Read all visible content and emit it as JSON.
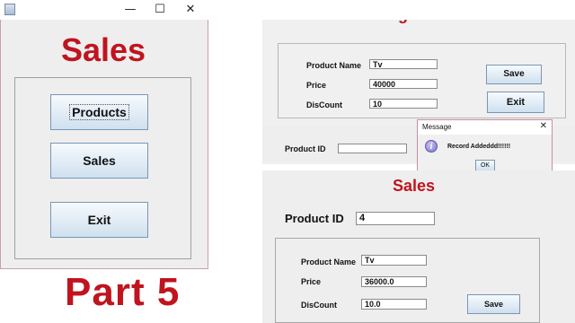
{
  "sales_window": {
    "minimize_glyph": "—",
    "maximize_glyph": "☐",
    "close_glyph": "✕",
    "heading": "Sales",
    "buttons": {
      "products": "Products",
      "sales": "Sales",
      "exit": "Exit"
    }
  },
  "registration": {
    "title": "Product Registation",
    "fields": {
      "name_label": "Product Name",
      "name_value": "Tv",
      "price_label": "Price",
      "price_value": "40000",
      "discount_label": "DisCount",
      "discount_value": "10",
      "id_label": "Product ID",
      "id_value": ""
    },
    "save_label": "Save",
    "exit_label": "Exit"
  },
  "message_dialog": {
    "title": "Message",
    "close_glyph": "✕",
    "info_glyph": "i",
    "text": "Record Addeddd!!!!!!",
    "ok_label": "OK"
  },
  "sales_form": {
    "title": "Sales",
    "product_id_label": "Product ID",
    "product_id_value": "4",
    "name_label": "Product Name",
    "name_value": "Tv",
    "price_label": "Price",
    "price_value": "36000.0",
    "discount_label": "DisCount",
    "discount_value": "10.0",
    "save_label": "Save"
  },
  "caption": "Part 5",
  "colors": {
    "accent_red": "#c0141e",
    "button_top": "#f6fafd",
    "button_bottom": "#cfe0ef"
  }
}
